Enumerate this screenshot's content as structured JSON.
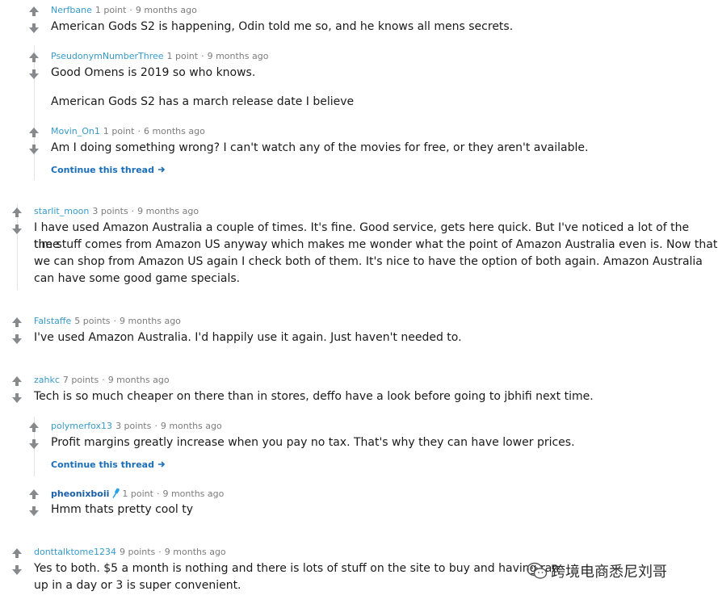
{
  "comments": [
    {
      "author": "Nerfbane",
      "points": "1 point",
      "time": "9 months ago",
      "lines": [
        "American Gods S2 is happening, Odin told me so, and he knows all mens secrets."
      ]
    },
    {
      "author": "PseudonymNumberThree",
      "points": "1 point",
      "time": "9 months ago",
      "lines": [
        "Good Omens is 2019 so who knows.",
        "American Gods S2 has a march release date I believe"
      ]
    },
    {
      "author": "Movin_On1",
      "points": "1 point",
      "time": "6 months ago",
      "lines": [
        "Am I doing something wrong? I can't watch any of the movies for free, or they aren't available."
      ]
    },
    {
      "author": "starlit_moon",
      "points": "3 points",
      "time": "9 months ago",
      "lines": [
        "I have used Amazon Australia a couple of times. It's fine. Good service, gets here quick. But I've noticed a lot of the time",
        "the stuff comes from Amazon US anyway which makes me wonder what the point of Amazon Australia even is. Now that",
        "we can shop from Amazon US again I check both of them. It's nice to have the option of both again. Amazon Australia",
        "can have some good game specials."
      ]
    },
    {
      "author": "Falstaffe",
      "points": "5 points",
      "time": "9 months ago",
      "lines": [
        "I've used Amazon Australia. I'd happily use it again. Just haven't needed to."
      ]
    },
    {
      "author": "zahkc",
      "points": "7 points",
      "time": "9 months ago",
      "lines": [
        "Tech is so much cheaper on there than in stores, deffo have a look before going to jbhifi next time."
      ]
    },
    {
      "author": "polymerfox13",
      "points": "3 points",
      "time": "9 months ago",
      "lines": [
        "Profit margins greatly increase when you pay no tax. That's why they can have lower prices."
      ]
    },
    {
      "author": "pheonixboii",
      "points": "1 point",
      "time": "9 months ago",
      "lines": [
        "Hmm thats pretty cool ty"
      ]
    },
    {
      "author": "donttalktome1234",
      "points": "9 points",
      "time": "9 months ago",
      "lines": [
        "Yes to both. $5 a month is nothing and there is lots of stuff on the site to buy and having ran",
        "up in a day or 3 is super convenient."
      ]
    }
  ],
  "continue_label": "Continue this thread",
  "separator": "·",
  "icons": {
    "upvote": "arrow-up-icon",
    "downvote": "arrow-down-icon",
    "continue": "arrow-right-icon",
    "mic": "microphone-icon",
    "watermark": "wechat-icon"
  },
  "colors": {
    "author": "#369ac7",
    "continue": "#1a6eb6",
    "meta": "#7c7c7c",
    "arrow": "#878a8c"
  },
  "watermark": {
    "text": "跨境电商悉尼刘哥"
  }
}
